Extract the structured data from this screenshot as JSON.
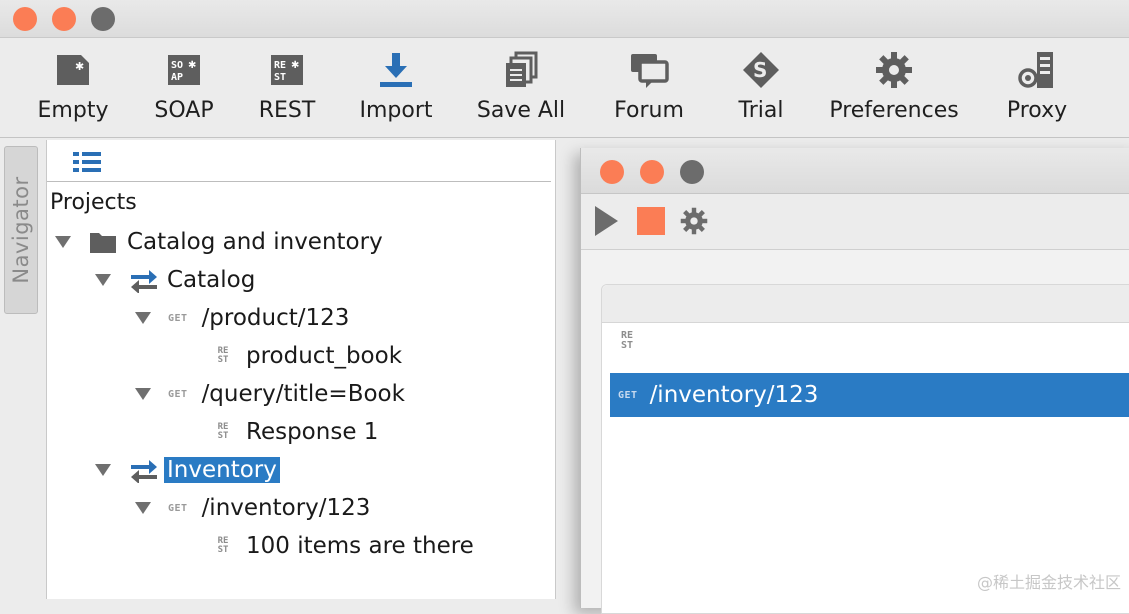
{
  "toolbar": {
    "items": [
      {
        "label": "Empty",
        "icon": "empty-project-icon"
      },
      {
        "label": "SOAP",
        "icon": "soap-project-icon"
      },
      {
        "label": "REST",
        "icon": "rest-project-icon"
      },
      {
        "label": "Import",
        "icon": "import-icon"
      },
      {
        "label": "Save All",
        "icon": "save-all-icon"
      },
      {
        "label": "Forum",
        "icon": "forum-icon"
      },
      {
        "label": "Trial",
        "icon": "trial-icon"
      },
      {
        "label": "Preferences",
        "icon": "gear-icon"
      },
      {
        "label": "Proxy",
        "icon": "proxy-icon"
      }
    ]
  },
  "navigator": {
    "tab_label": "Navigator",
    "projects_label": "Projects",
    "tree": {
      "project": "Catalog and inventory",
      "catalog": "Catalog",
      "product_path": "/product/123",
      "product_response": "product_book",
      "query_path": "/query/title=Book",
      "query_response": "Response 1",
      "inventory": "Inventory",
      "inventory_path": "/inventory/123",
      "inventory_response": "100 items are there"
    },
    "get_badge": "GET",
    "rest_badge_top": "RE",
    "rest_badge_bottom": "ST"
  },
  "subwindow": {
    "rest_badge_top": "RE",
    "rest_badge_bottom": "ST",
    "get_badge": "GET",
    "selected_path": "/inventory/123"
  },
  "watermark": "@稀土掘金技术社区",
  "colors": {
    "traffic_light": "#fb7d55",
    "selection": "#2a7bc4",
    "run_orange": "#fb7d55"
  }
}
